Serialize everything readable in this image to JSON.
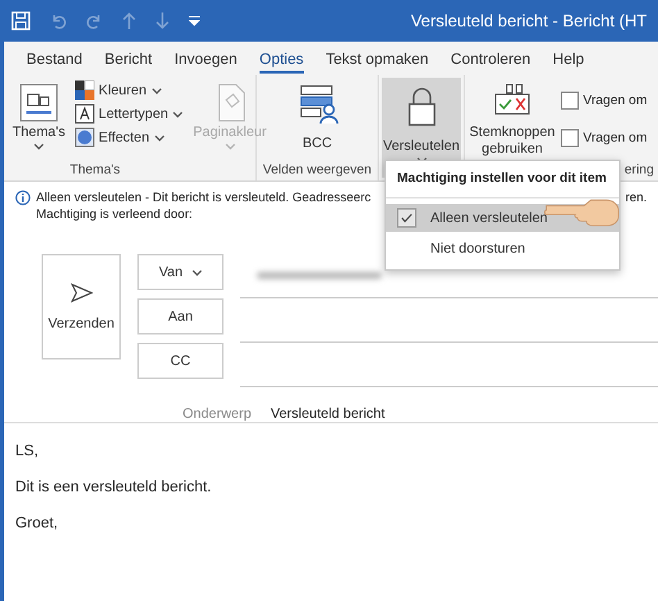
{
  "window": {
    "title": "Versleuteld bericht  -  Bericht (HT"
  },
  "tabs": [
    {
      "label": "Bestand",
      "selected": false
    },
    {
      "label": "Bericht",
      "selected": false
    },
    {
      "label": "Invoegen",
      "selected": false
    },
    {
      "label": "Opties",
      "selected": true
    },
    {
      "label": "Tekst opmaken",
      "selected": false
    },
    {
      "label": "Controleren",
      "selected": false
    },
    {
      "label": "Help",
      "selected": false
    }
  ],
  "ribbon": {
    "themes": {
      "button": "Thema's",
      "items": [
        "Kleuren",
        "Lettertypen",
        "Effecten"
      ],
      "group_label": "Thema's"
    },
    "page_color": {
      "label": "Paginakleur",
      "disabled": true
    },
    "fields": {
      "button": "BCC",
      "group_label": "Velden weergeven"
    },
    "encrypt": {
      "label": "Versleutelen",
      "expanded": true
    },
    "voting": {
      "label": "Stemknoppen gebruiken"
    },
    "checkboxes": [
      {
        "label": "Vragen om",
        "checked": false
      },
      {
        "label": "Vragen om",
        "checked": false
      }
    ],
    "tracking_group_label": "ering"
  },
  "info_bar": {
    "text_start": "Alleen versleutelen - Dit bericht is versleuteld. Geadresseerc",
    "text_end": "ren.",
    "line_2": "Machtiging is verleend door:"
  },
  "permission_menu": {
    "title": "Machtiging instellen voor dit item",
    "items": [
      {
        "label": "Alleen versleutelen",
        "selected": true
      },
      {
        "label": "Niet doorsturen",
        "selected": false
      }
    ]
  },
  "compose": {
    "send_button": "Verzenden",
    "fields": [
      {
        "label": "Van",
        "kind": "dropdown"
      },
      {
        "label": "Aan",
        "kind": "button"
      },
      {
        "label": "CC",
        "kind": "button"
      }
    ],
    "subject_label": "Onderwerp",
    "subject": "Versleuteld bericht"
  },
  "body": [
    "LS,",
    "Dit is een versleuteld bericht.",
    "Groet,"
  ]
}
